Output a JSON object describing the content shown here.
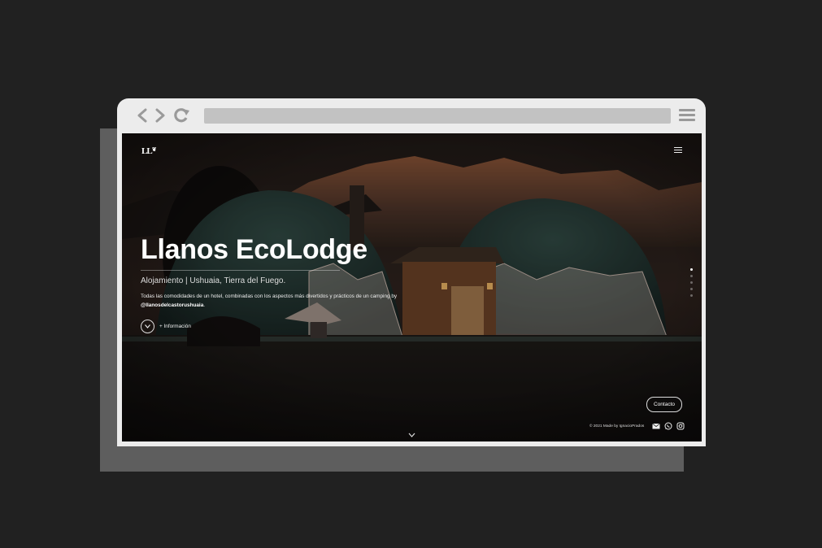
{
  "colors": {
    "backdrop": "#212121",
    "browser_frame": "#ececec",
    "shadow": "#5e5e5e",
    "address_bar": "#c2c2c2"
  },
  "browser": {
    "nav_icons": [
      "back-arrow-icon",
      "forward-arrow-icon",
      "reload-icon",
      "menu-icon"
    ]
  },
  "site": {
    "logo": "LL",
    "hero": {
      "title": "Llanos EcoLodge",
      "subtitle": "Alojamiento | Ushuaia, Tierra del Fuego.",
      "description": "Todas las comodidades de un hotel, combinadas con los aspectos más divertidos y prácticos de un camping by",
      "handle": "@llanosdelcastorushuaia",
      "handle_suffix": ".",
      "info_label": "+ Información"
    },
    "contact_label": "Contacto",
    "footer": {
      "copyright": "© 2021 Made by IgnacioPrados"
    },
    "social_icons": [
      "mail-icon",
      "whatsapp-icon",
      "instagram-icon"
    ],
    "slide_count": 5,
    "active_slide": 1
  }
}
